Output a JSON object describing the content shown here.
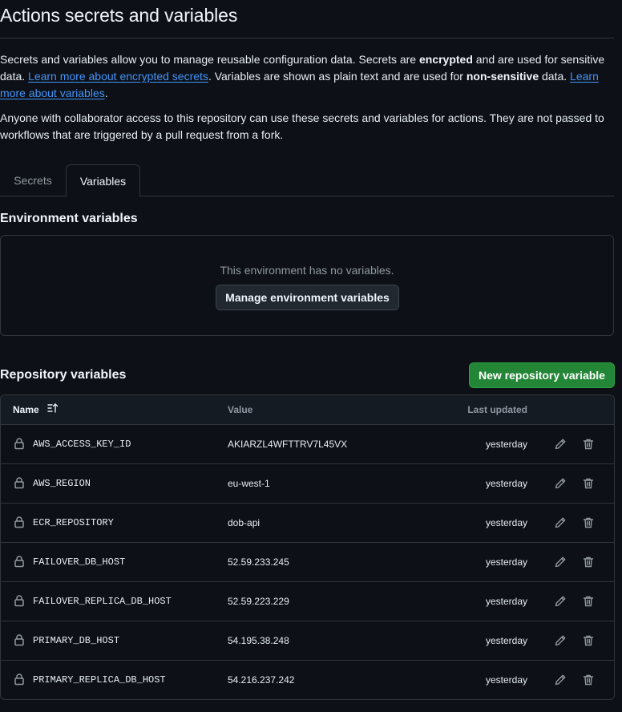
{
  "page": {
    "title": "Actions secrets and variables",
    "intro": {
      "p1_a": "Secrets and variables allow you to manage reusable configuration data. Secrets are ",
      "p1_bold1": "encrypted",
      "p1_b": " and are used for sensitive data. ",
      "p1_link1": "Learn more about encrypted secrets",
      "p1_c": ". Variables are shown as plain text and are used for ",
      "p1_bold2": "non-sensitive",
      "p1_d": " data. ",
      "p1_link2": "Learn more about variables",
      "p1_e": ".",
      "p2": "Anyone with collaborator access to this repository can use these secrets and variables for actions. They are not passed to workflows that are triggered by a pull request from a fork."
    }
  },
  "tabs": [
    {
      "label": "Secrets",
      "selected": false
    },
    {
      "label": "Variables",
      "selected": true
    }
  ],
  "environment": {
    "heading": "Environment variables",
    "empty_text": "This environment has no variables.",
    "manage_button": "Manage environment variables"
  },
  "repository": {
    "heading": "Repository variables",
    "new_button": "New repository variable",
    "columns": {
      "name": "Name",
      "value": "Value",
      "updated": "Last updated"
    },
    "rows": [
      {
        "name": "AWS_ACCESS_KEY_ID",
        "value": "AKIARZL4WFTTRV7L45VX",
        "updated": "yesterday"
      },
      {
        "name": "AWS_REGION",
        "value": "eu-west-1",
        "updated": "yesterday"
      },
      {
        "name": "ECR_REPOSITORY",
        "value": "dob-api",
        "updated": "yesterday"
      },
      {
        "name": "FAILOVER_DB_HOST",
        "value": "52.59.233.245",
        "updated": "yesterday"
      },
      {
        "name": "FAILOVER_REPLICA_DB_HOST",
        "value": "52.59.223.229",
        "updated": "yesterday"
      },
      {
        "name": "PRIMARY_DB_HOST",
        "value": "54.195.38.248",
        "updated": "yesterday"
      },
      {
        "name": "PRIMARY_REPLICA_DB_HOST",
        "value": "54.216.237.242",
        "updated": "yesterday"
      }
    ]
  },
  "colors": {
    "background": "#0d1117",
    "border": "#30363d",
    "link": "#4493f8",
    "primary_button": "#238636"
  }
}
